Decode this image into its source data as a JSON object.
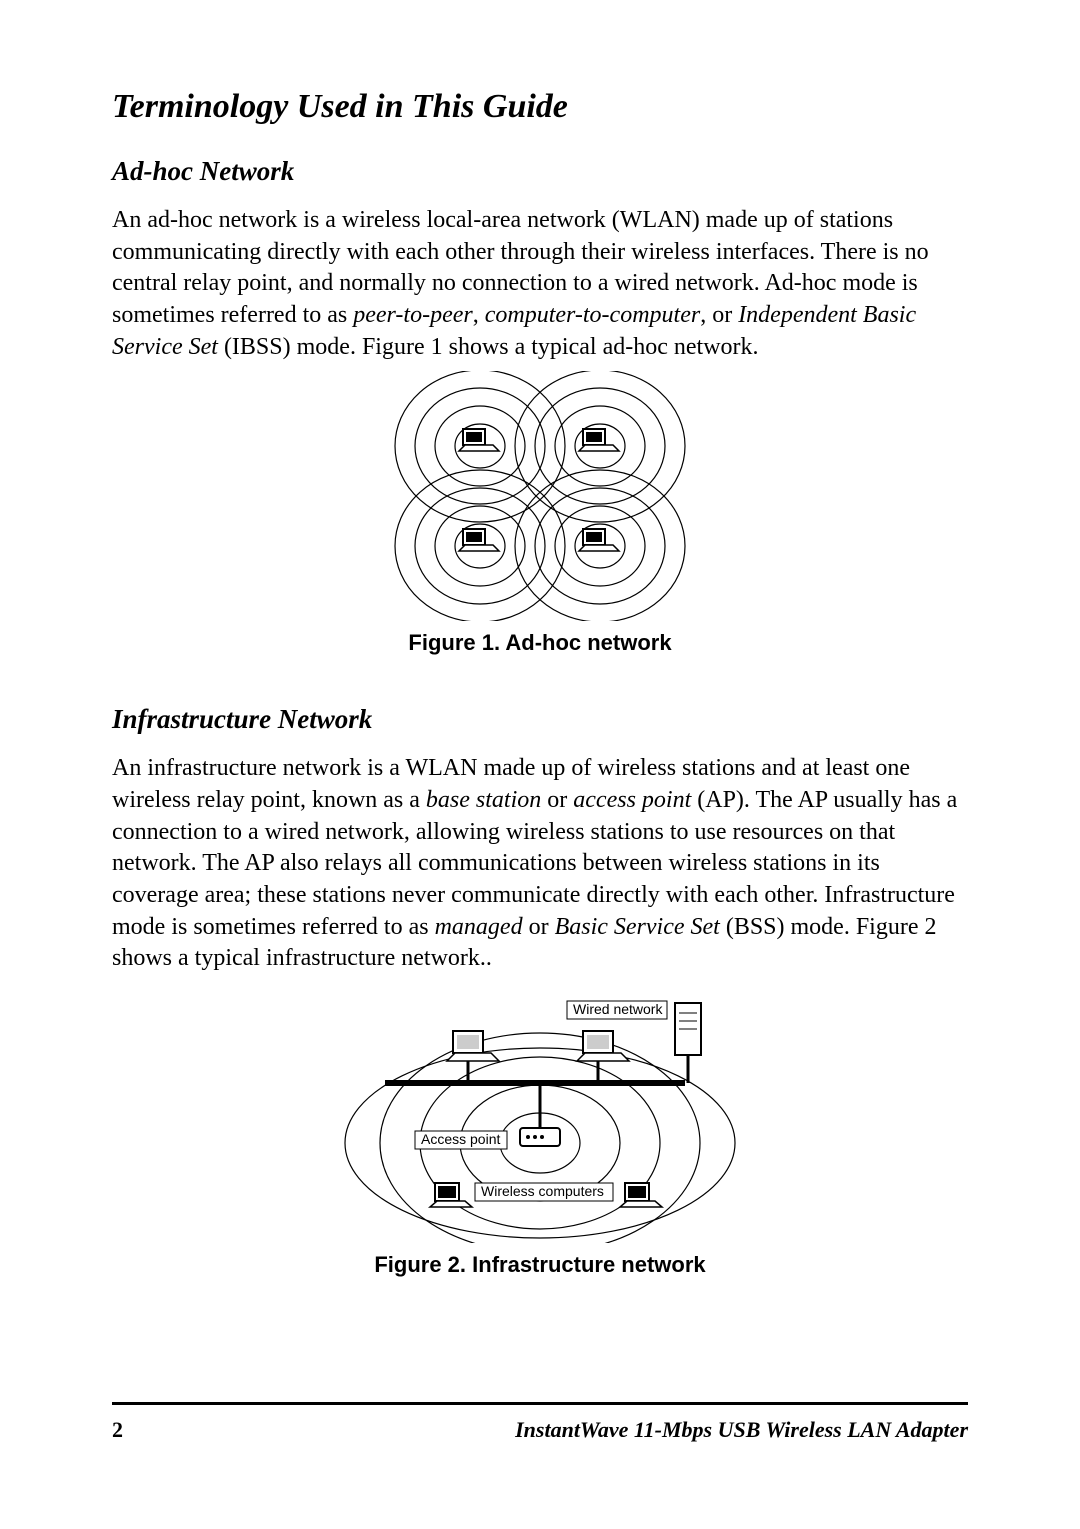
{
  "heading": "Terminology Used in This Guide",
  "section1": {
    "title": "Ad-hoc Network",
    "p1a": "An ad-hoc network is a wireless local-area network (WLAN) made up of stations communicating directly with each other through their wireless interfaces. There is no central relay point, and normally no connection to a wired network. Ad-hoc mode is sometimes referred to as ",
    "p1b": "peer-to-peer",
    "p1c": ", ",
    "p1d": "computer-to-computer",
    "p1e": ", or ",
    "p1f": "Independent Basic Service Set",
    "p1g": " (IBSS) mode. Figure 1 shows a typical ad-hoc network.",
    "figcap": "Figure 1.  Ad-hoc network"
  },
  "section2": {
    "title": "Infrastructure Network",
    "p1a": "An infrastructure network is a WLAN made up of wireless stations and at least one wireless relay point, known as a ",
    "p1b": "base station",
    "p1c": " or ",
    "p1d": "access point",
    "p1e": " (AP). The AP usually has a connection to a wired network, allowing wireless stations to use resources on that network. The AP also relays all communications between wireless stations in its coverage area; these stations never communicate directly with each other. Infrastructure mode is sometimes referred to as ",
    "p1f": "managed",
    "p1g": " or ",
    "p1h": "Basic Service Set",
    "p1i": " (BSS) mode. Figure 2 shows a typical infrastructure network..",
    "figcap": "Figure 2.  Infrastructure network",
    "labels": {
      "wired": "Wired network",
      "ap": "Access point",
      "wc": "Wireless computers"
    }
  },
  "footer": {
    "page": "2",
    "title": "InstantWave 11-Mbps USB Wireless LAN Adapter"
  }
}
